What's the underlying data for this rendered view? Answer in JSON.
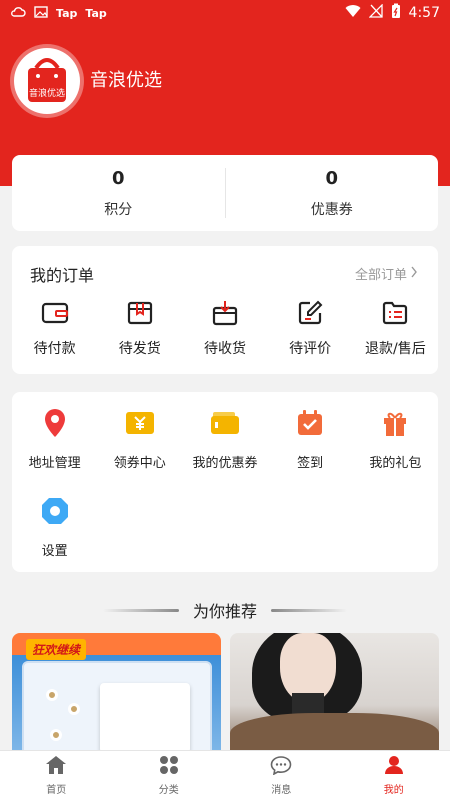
{
  "status_bar": {
    "app1": "Tap",
    "app2": "Tap",
    "time": "4:57"
  },
  "header": {
    "brand_name": "音浪优选",
    "logo_text": "音浪优选"
  },
  "stats": [
    {
      "value": "0",
      "label": "积分"
    },
    {
      "value": "0",
      "label": "优惠券"
    }
  ],
  "orders": {
    "title": "我的订单",
    "view_all": "全部订单",
    "items": [
      {
        "label": "待付款",
        "icon": "wallet-icon"
      },
      {
        "label": "待发货",
        "icon": "box-icon"
      },
      {
        "label": "待收货",
        "icon": "receive-box-icon"
      },
      {
        "label": "待评价",
        "icon": "edit-icon"
      },
      {
        "label": "退款/售后",
        "icon": "list-icon"
      }
    ]
  },
  "services": {
    "items": [
      {
        "label": "地址管理",
        "icon": "location-pin-icon"
      },
      {
        "label": "领券中心",
        "icon": "coupon-icon"
      },
      {
        "label": "我的优惠券",
        "icon": "wallet-card-icon"
      },
      {
        "label": "签到",
        "icon": "calendar-check-icon"
      },
      {
        "label": "我的礼包",
        "icon": "gift-icon"
      },
      {
        "label": "设置",
        "icon": "settings-icon"
      }
    ]
  },
  "recommend": {
    "title": "为你推荐",
    "product1_badge": "狂欢继续"
  },
  "tabbar": [
    {
      "label": "首页",
      "icon": "home-icon"
    },
    {
      "label": "分类",
      "icon": "category-icon"
    },
    {
      "label": "消息",
      "icon": "message-icon"
    },
    {
      "label": "我的",
      "icon": "profile-icon",
      "active": true
    }
  ],
  "colors": {
    "accent": "#e3251e",
    "orange": "#f26b3a",
    "gold": "#f4b400",
    "blue": "#3ea9f5"
  }
}
